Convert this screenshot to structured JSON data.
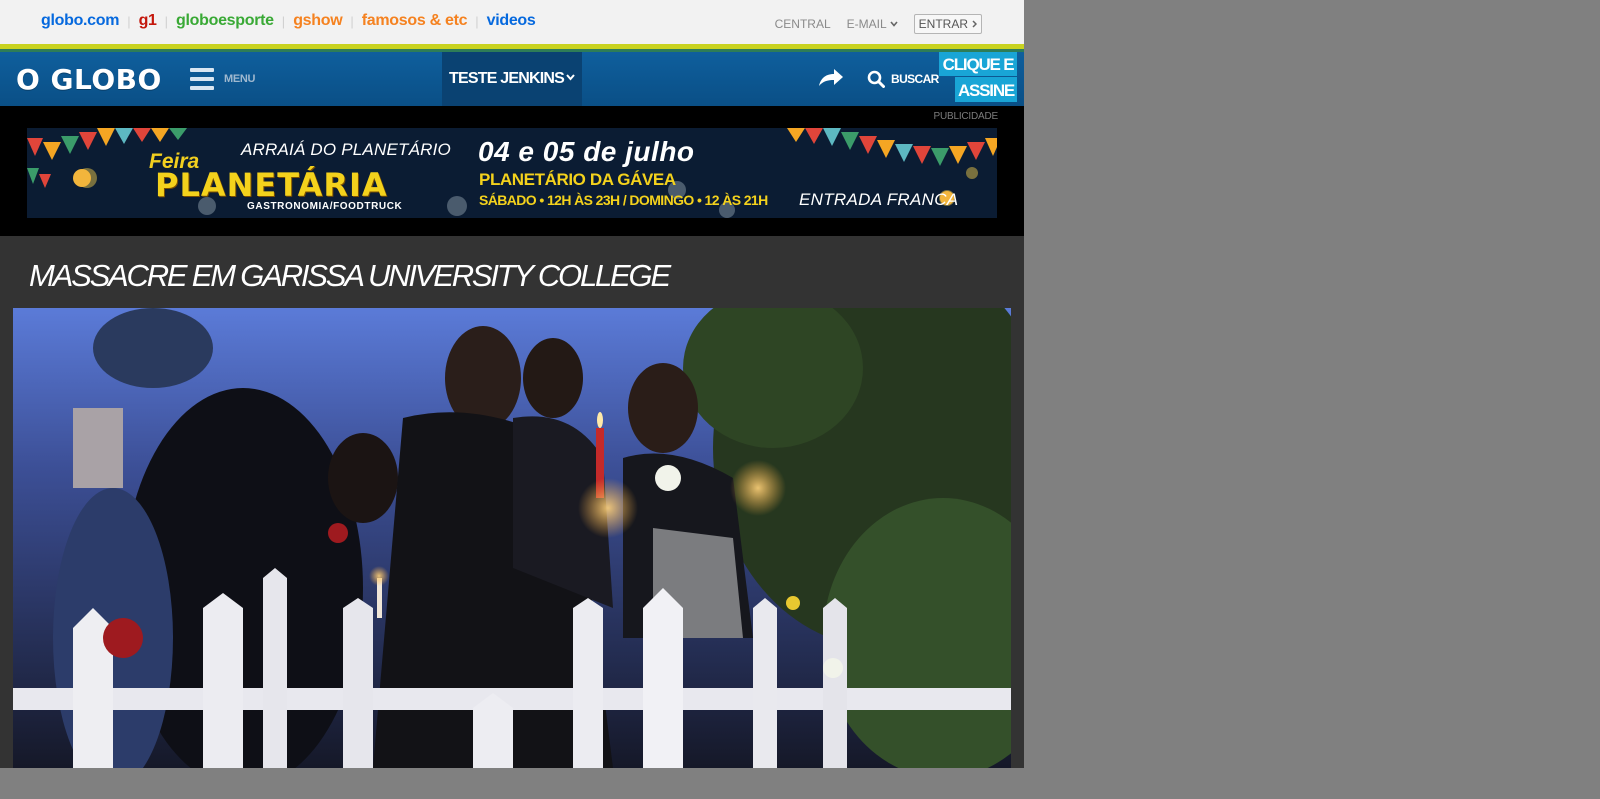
{
  "topbar": {
    "links": [
      {
        "label": "globo.com",
        "color": "#0669de"
      },
      {
        "label": "g1",
        "color": "#c4170c"
      },
      {
        "label": "globoesporte",
        "color": "#39a935"
      },
      {
        "label": "gshow",
        "color": "#f58220"
      },
      {
        "label": "famosos & etc",
        "color": "#f58220"
      },
      {
        "label": "videos",
        "color": "#0669de"
      }
    ],
    "central": "CENTRAL",
    "email": "E-MAIL",
    "entrar": "ENTRAR"
  },
  "header": {
    "logo": "O GLOBO",
    "menu": "MENU",
    "section": "TESTE JENKINS",
    "search": "BUSCAR",
    "subscribe_line1": "CLIQUE E",
    "subscribe_line2": "ASSINE",
    "icons": [
      "menu-icon",
      "chevron-down-icon",
      "share-icon",
      "search-icon"
    ]
  },
  "ad": {
    "label": "PUBLICIDADE",
    "arraia": "ARRAIÁ DO PLANETÁRIO",
    "feira": "Feira",
    "planetaria": "PLANETÁRIA",
    "gastronomia": "GASTRONOMIA/FOODTRUCK",
    "date": "04 e 05 de julho",
    "place": "PLANETÁRIO DA GÁVEA",
    "times": "SÁBADO • 12H ÀS 23H / DOMINGO • 12 ÀS 21H",
    "entrada": "ENTRADA FRANCA"
  },
  "article": {
    "title": "MASSACRE EM GARISSA UNIVERSITY COLLEGE"
  },
  "colors": {
    "header_blue": "#0f5f9d",
    "stripe_yellow": "#c9d320",
    "subscribe_blue": "#19a5d6",
    "page_bg": "#333333",
    "outside_bg": "#808080"
  }
}
